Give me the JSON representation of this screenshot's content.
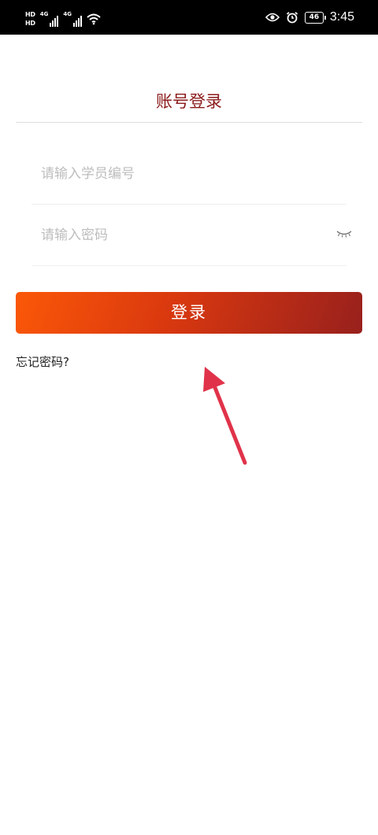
{
  "status_bar": {
    "hd1": "HD",
    "hd2": "HD",
    "net1": "4G",
    "net2": "4G",
    "battery": "46",
    "time": "3:45"
  },
  "login": {
    "title": "账号登录",
    "student_id_placeholder": "请输入学员编号",
    "password_placeholder": "请输入密码",
    "submit_label": "登录",
    "forgot_label": "忘记密码?"
  },
  "colors": {
    "title": "#8b1a1a",
    "button_start": "#fb5808",
    "button_end": "#98201d",
    "annotation_arrow": "#e0334a"
  },
  "icons": {
    "eye": "eye-closed-icon",
    "wifi": "wifi-icon",
    "alarm": "alarm-icon",
    "view": "eye-icon"
  }
}
